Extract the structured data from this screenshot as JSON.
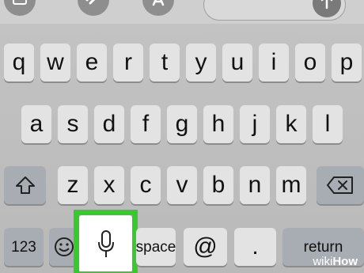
{
  "keyboard": {
    "row1": [
      "q",
      "w",
      "e",
      "r",
      "t",
      "y",
      "u",
      "i",
      "o",
      "p"
    ],
    "row2": [
      "a",
      "s",
      "d",
      "f",
      "g",
      "h",
      "j",
      "k",
      "l"
    ],
    "row3": [
      "z",
      "x",
      "c",
      "v",
      "b",
      "n",
      "m"
    ],
    "numbers_key": "123",
    "space_key": "space",
    "at_key": "@",
    "period_key": ".",
    "return_key": "return"
  },
  "icons": {
    "shift": "shift-icon",
    "backspace": "backspace-icon",
    "emoji": "emoji-icon",
    "mic": "microphone-icon"
  },
  "highlight_color": "#38c92c",
  "watermark": {
    "prefix": "wiki",
    "suffix": "How"
  }
}
